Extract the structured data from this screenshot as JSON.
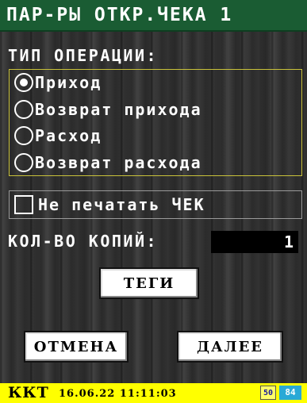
{
  "header": {
    "title": "ПАР-РЫ ОТКР.ЧЕКА 1"
  },
  "operation_type": {
    "label": "ТИП ОПЕРАЦИИ:",
    "options": [
      {
        "label": "Приход",
        "selected": true
      },
      {
        "label": "Возврат прихода",
        "selected": false
      },
      {
        "label": "Расход",
        "selected": false
      },
      {
        "label": "Возврат расхода",
        "selected": false
      }
    ]
  },
  "no_print_check": {
    "label": "Не печатать ЧЕК",
    "checked": false
  },
  "copies": {
    "label": "КОЛ-ВО КОПИЙ:",
    "value": "1"
  },
  "buttons": {
    "tags": "ТЕГИ",
    "cancel": "ОТМЕНА",
    "next": "ДАЛЕЕ"
  },
  "status_bar": {
    "device": "ККТ",
    "datetime": "16.06.22 11:11:03",
    "badge1": "50",
    "badge2": "84"
  },
  "colors": {
    "title_bar": "#1a5c33",
    "status_bar": "#ffff00",
    "group_border": "#c9c23a",
    "badge2_bg": "#29a9d6"
  }
}
